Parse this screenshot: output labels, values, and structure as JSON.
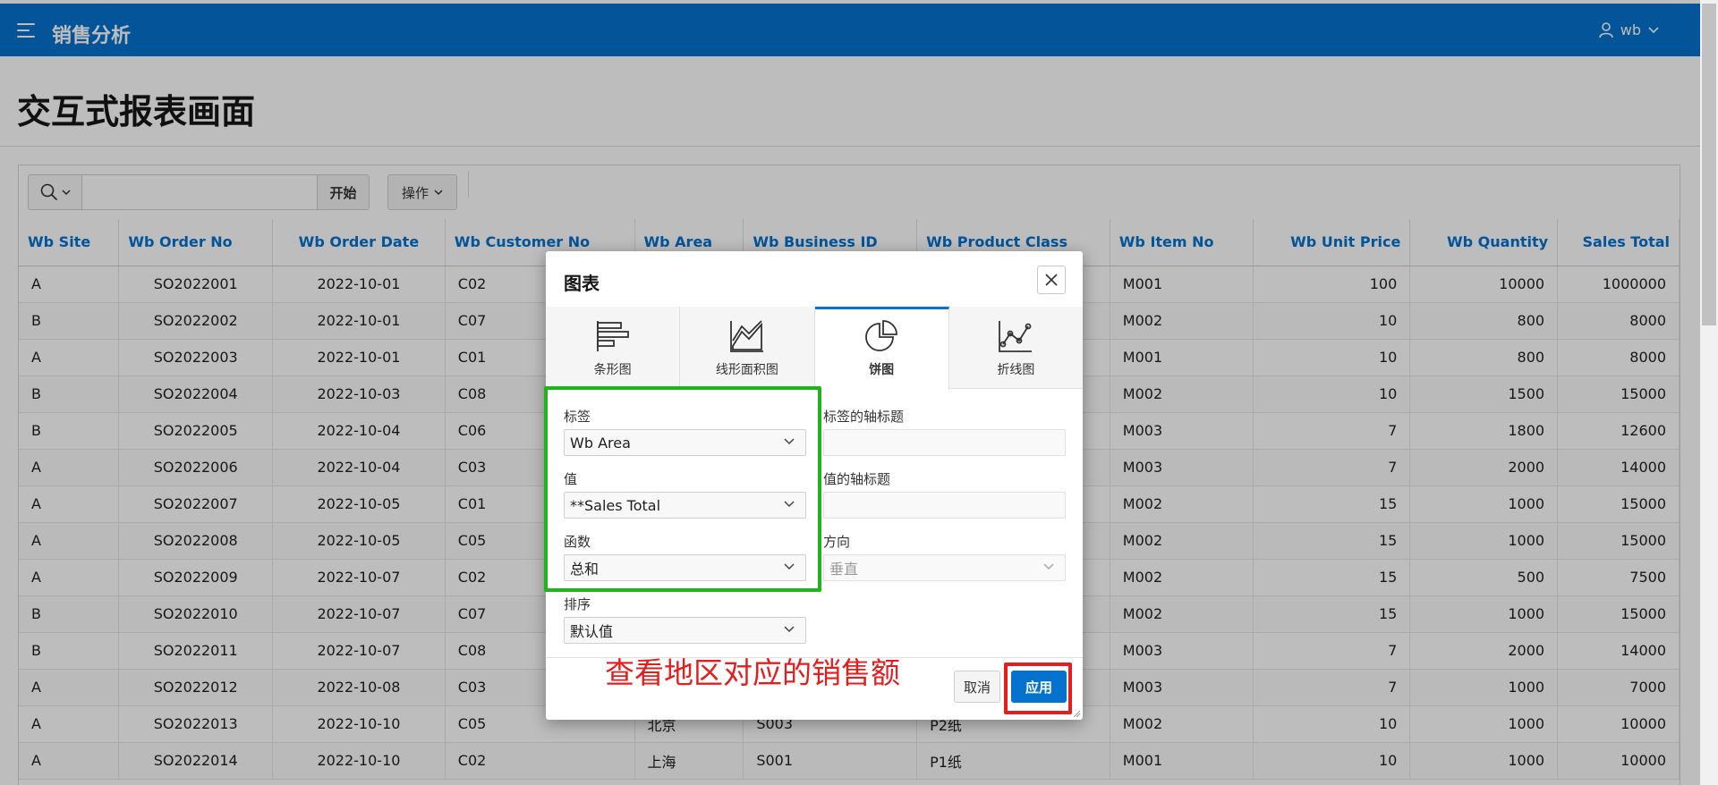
{
  "header": {
    "app_title": "销售分析",
    "user_name": "wb"
  },
  "page": {
    "title": "交互式报表画面"
  },
  "toolbar": {
    "search_placeholder": "",
    "go_label": "开始",
    "actions_label": "操作"
  },
  "report": {
    "columns": [
      "Wb Site",
      "Wb Order No",
      "Wb Order Date",
      "Wb Customer No",
      "Wb Area",
      "Wb Business ID",
      "Wb Product Class",
      "Wb Item No",
      "Wb Unit Price",
      "Wb Quantity",
      "Sales Total"
    ],
    "rows": [
      [
        "A",
        "SO2022001",
        "2022-10-01",
        "C02",
        "",
        "",
        "",
        "M001",
        "100",
        "10000",
        "1000000"
      ],
      [
        "B",
        "SO2022002",
        "2022-10-01",
        "C07",
        "",
        "",
        "",
        "M002",
        "10",
        "800",
        "8000"
      ],
      [
        "A",
        "SO2022003",
        "2022-10-01",
        "C01",
        "",
        "",
        "",
        "M001",
        "10",
        "800",
        "8000"
      ],
      [
        "B",
        "SO2022004",
        "2022-10-03",
        "C08",
        "",
        "",
        "",
        "M002",
        "10",
        "1500",
        "15000"
      ],
      [
        "B",
        "SO2022005",
        "2022-10-04",
        "C06",
        "",
        "",
        "",
        "M003",
        "7",
        "1800",
        "12600"
      ],
      [
        "A",
        "SO2022006",
        "2022-10-04",
        "C03",
        "",
        "",
        "",
        "M003",
        "7",
        "2000",
        "14000"
      ],
      [
        "A",
        "SO2022007",
        "2022-10-05",
        "C01",
        "",
        "",
        "",
        "M002",
        "15",
        "1000",
        "15000"
      ],
      [
        "A",
        "SO2022008",
        "2022-10-05",
        "C05",
        "",
        "",
        "",
        "M002",
        "15",
        "1000",
        "15000"
      ],
      [
        "A",
        "SO2022009",
        "2022-10-07",
        "C02",
        "",
        "",
        "",
        "M002",
        "15",
        "500",
        "7500"
      ],
      [
        "B",
        "SO2022010",
        "2022-10-07",
        "C07",
        "",
        "",
        "",
        "M002",
        "15",
        "1000",
        "15000"
      ],
      [
        "B",
        "SO2022011",
        "2022-10-07",
        "C08",
        "",
        "",
        "",
        "M003",
        "7",
        "2000",
        "14000"
      ],
      [
        "A",
        "SO2022012",
        "2022-10-08",
        "C03",
        "",
        "",
        "",
        "M003",
        "7",
        "1000",
        "7000"
      ],
      [
        "A",
        "SO2022013",
        "2022-10-10",
        "C05",
        "北京",
        "S003",
        "P2纸",
        "M002",
        "10",
        "1000",
        "10000"
      ],
      [
        "A",
        "SO2022014",
        "2022-10-10",
        "C02",
        "上海",
        "S001",
        "P1纸",
        "M001",
        "10",
        "1000",
        "10000"
      ]
    ]
  },
  "dialog": {
    "title": "图表",
    "tabs": [
      "条形图",
      "线形面积图",
      "饼图",
      "折线图"
    ],
    "active_tab": "饼图",
    "label_field_label": "标签",
    "label_field_value": "Wb Area",
    "value_field_label": "值",
    "value_field_value": "**Sales Total",
    "function_label": "函数",
    "function_value": "总和",
    "sort_label": "排序",
    "sort_value": "默认值",
    "label_axis_title_label": "标签的轴标题",
    "value_axis_title_label": "值的轴标题",
    "orientation_label": "方向",
    "orientation_value": "垂直",
    "cancel_label": "取消",
    "apply_label": "应用"
  },
  "annotation": {
    "text": "查看地区对应的销售额",
    "highlight_color": "#22b21f",
    "callout_color": "#e41e1e"
  },
  "colors": {
    "brand": "#0572ce"
  }
}
